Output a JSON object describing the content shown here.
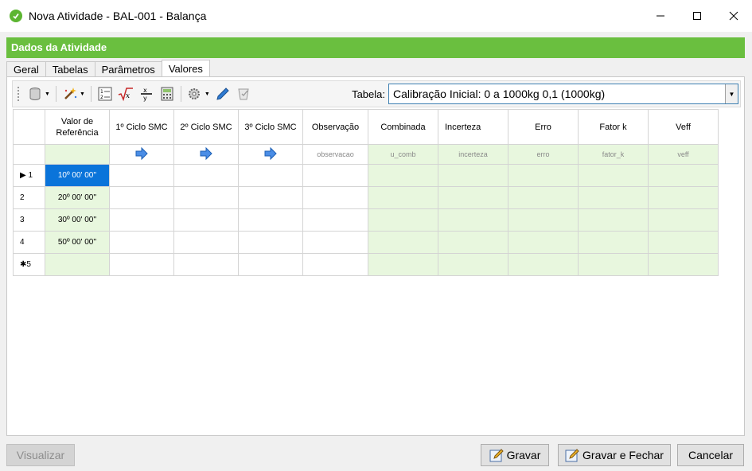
{
  "window": {
    "title": "Nova Atividade - BAL-001 - Balança"
  },
  "section": {
    "title": "Dados da Atividade"
  },
  "tabs": [
    {
      "label": "Geral"
    },
    {
      "label": "Tabelas"
    },
    {
      "label": "Parâmetros"
    },
    {
      "label": "Valores"
    }
  ],
  "toolbar": {
    "icons": [
      "database-icon",
      "magic-wand-icon",
      "numbered-list-icon",
      "sqrt-fx-icon",
      "divide-icon",
      "calculator-icon",
      "settings-gears-icon",
      "edit-pencil-icon",
      "clipboard-icon"
    ],
    "tabela_label": "Tabela:",
    "tabela_value": "Calibração Inicial: 0 a 1000kg 0,1 (1000kg)"
  },
  "grid": {
    "headers": {
      "ref": "Valor de Referência",
      "c1": "1º Ciclo SMC",
      "c2": "2º Ciclo SMC",
      "c3": "3º Ciclo SMC",
      "obs": "Observação",
      "comb": "Combinada",
      "inc": "Incerteza",
      "erro": "Erro",
      "fk": "Fator k",
      "veff": "Veff"
    },
    "format_row": {
      "obs": "observacao",
      "comb": "u_comb",
      "inc": "incerteza",
      "erro": "erro",
      "fk": "fator_k",
      "veff": "veff"
    },
    "rows": [
      {
        "marker": "▶",
        "num": "1",
        "ref": "10º 00' 00''"
      },
      {
        "marker": "",
        "num": "2",
        "ref": "20º 00' 00''"
      },
      {
        "marker": "",
        "num": "3",
        "ref": "30º 00' 00''"
      },
      {
        "marker": "",
        "num": "4",
        "ref": "50º 00' 00''"
      },
      {
        "marker": "✱",
        "num": "5",
        "ref": ""
      }
    ]
  },
  "footer": {
    "visualizar": "Visualizar",
    "gravar": "Gravar",
    "gravar_fechar": "Gravar e Fechar",
    "cancelar": "Cancelar"
  },
  "colors": {
    "header_green": "#6abf3f",
    "cell_green": "#e8f7de",
    "selection_blue": "#0a74da"
  }
}
